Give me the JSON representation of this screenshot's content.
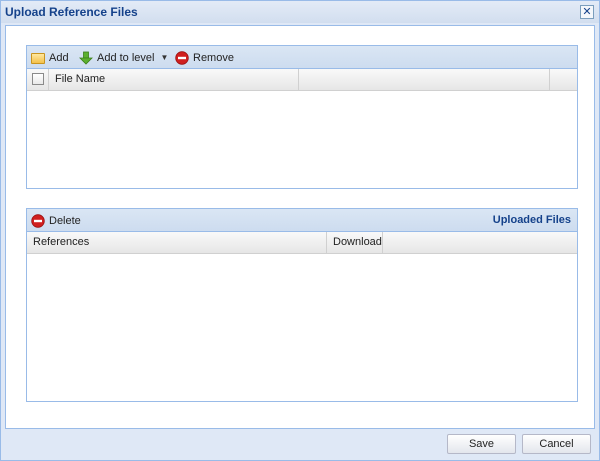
{
  "window": {
    "title": "Upload Reference Files",
    "close_glyph": "✕"
  },
  "files_panel": {
    "toolbar": {
      "add_label": "Add",
      "add_to_level_label": "Add to level",
      "remove_label": "Remove"
    },
    "columns": [
      "File Name",
      ""
    ]
  },
  "uploaded_panel": {
    "title": "Uploaded Files",
    "toolbar": {
      "delete_label": "Delete"
    },
    "columns": [
      "References",
      "Download"
    ]
  },
  "footer": {
    "save_label": "Save",
    "cancel_label": "Cancel"
  },
  "colors": {
    "accent": "#15428b",
    "border": "#99bbe8",
    "remove_red": "#d01f1f"
  }
}
